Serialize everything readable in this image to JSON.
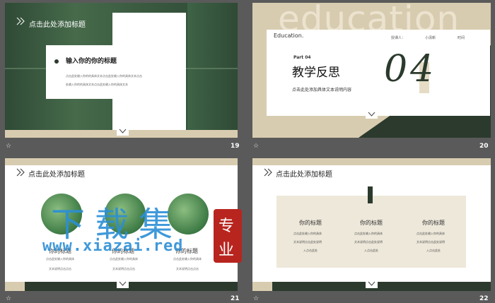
{
  "slides": [
    {
      "number": "19",
      "title": "点击此处添加标题",
      "card_title": "输入你的你的标题",
      "lines": [
        "点击此处输入你的的具体文本点击此处输入你的具体文本点击",
        "处输入你的的具体文本点击此处输入你的具体文本"
      ]
    },
    {
      "number": "20",
      "bg_word": "education",
      "brand": "Education.",
      "teacher_label": "授课人：",
      "teacher_name": "小清新",
      "time_label": "时间",
      "part": "Part 04",
      "title": "教学反思",
      "subtitle": "点击此处添加具体文本说明内容",
      "big_number": "04"
    },
    {
      "number": "21",
      "title": "点击此处添加标题",
      "items": [
        {
          "title": "你的标题",
          "line1": "点击此处输入你的具体",
          "line2": "文本说明点击点击"
        },
        {
          "title": "你的标题",
          "line1": "点击此处输入你的具体",
          "line2": "文本说明点击点击"
        },
        {
          "title": "你的标题",
          "line1": "点击此处输入你的具体",
          "line2": "文本说明点击点击"
        }
      ]
    },
    {
      "number": "22",
      "title": "点击此处添加标题",
      "columns": [
        {
          "title": "你的标题",
          "l1": "点击此处输入你的具体",
          "l2": "文本说明点击此处说明",
          "l3": "入点击此处"
        },
        {
          "title": "你的标题",
          "l1": "点击此处输入你的具体",
          "l2": "文本说明点击此处说明",
          "l3": "入点击此处"
        },
        {
          "title": "你的标题",
          "l1": "点击此处输入你的具体",
          "l2": "文本说明点击此处说明",
          "l3": "入点击此处"
        }
      ]
    }
  ],
  "watermark": {
    "text": "下载集",
    "url": "www.xiazai.red",
    "seal": [
      "专",
      "业"
    ]
  },
  "footer_icon": "star-icon",
  "colors": {
    "dark_green": "#2b3a2d",
    "beige": "#d8ccb0",
    "watermark_blue": "#2b8fd6",
    "seal_red": "#b8251f"
  }
}
